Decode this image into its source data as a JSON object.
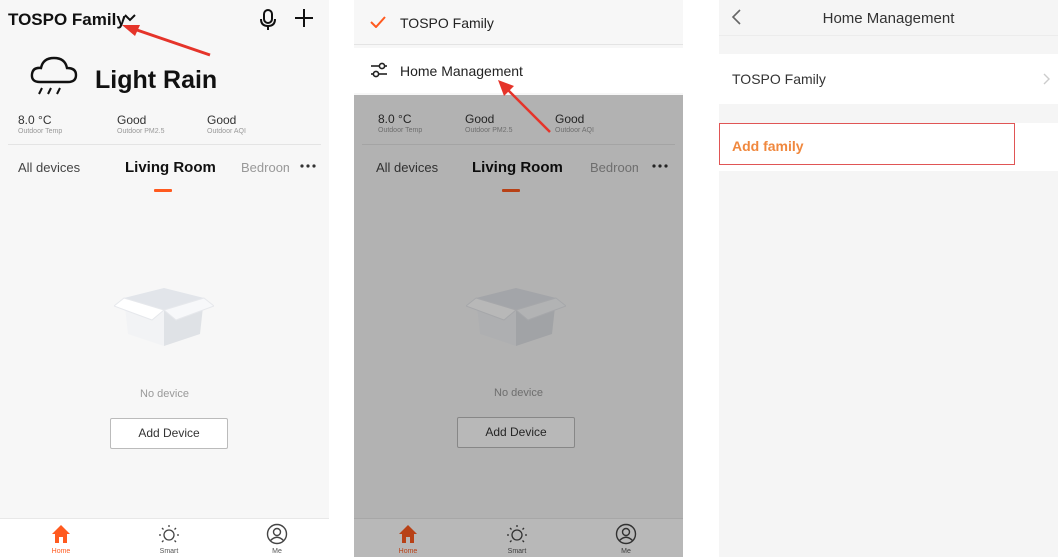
{
  "screens": {
    "home": {
      "family_title": "TOSPO Family",
      "weather": {
        "condition": "Light Rain"
      },
      "stats": [
        {
          "value": "8.0 °C",
          "label": "Outdoor Temp"
        },
        {
          "value": "Good",
          "label": "Outdoor PM2.5"
        },
        {
          "value": "Good",
          "label": "Outdoor AQI"
        }
      ],
      "tabs": [
        "All devices",
        "Living Room",
        "Bedroom"
      ],
      "active_tab": "Living Room",
      "empty_text": "No device",
      "add_device_label": "Add Device",
      "nav": [
        "Home",
        "Smart",
        "Me"
      ]
    },
    "menu": {
      "items": [
        "TOSPO Family",
        "Home Management"
      ]
    },
    "home_management": {
      "title": "Home Management",
      "families": [
        "TOSPO Family"
      ],
      "add_family_label": "Add family"
    }
  },
  "colors": {
    "accent": "#ff5a1f",
    "highlight_border": "#e05555",
    "add_family_text": "#f0883e",
    "annotation_arrow": "#e5342a"
  },
  "icons": [
    "chevron-down-icon",
    "microphone-icon",
    "plus-icon",
    "rain-cloud-icon",
    "more-dots-icon",
    "empty-box-icon",
    "home-icon",
    "sun-icon",
    "user-icon",
    "checkmark-icon",
    "sliders-icon",
    "back-icon",
    "chevron-right-icon"
  ]
}
